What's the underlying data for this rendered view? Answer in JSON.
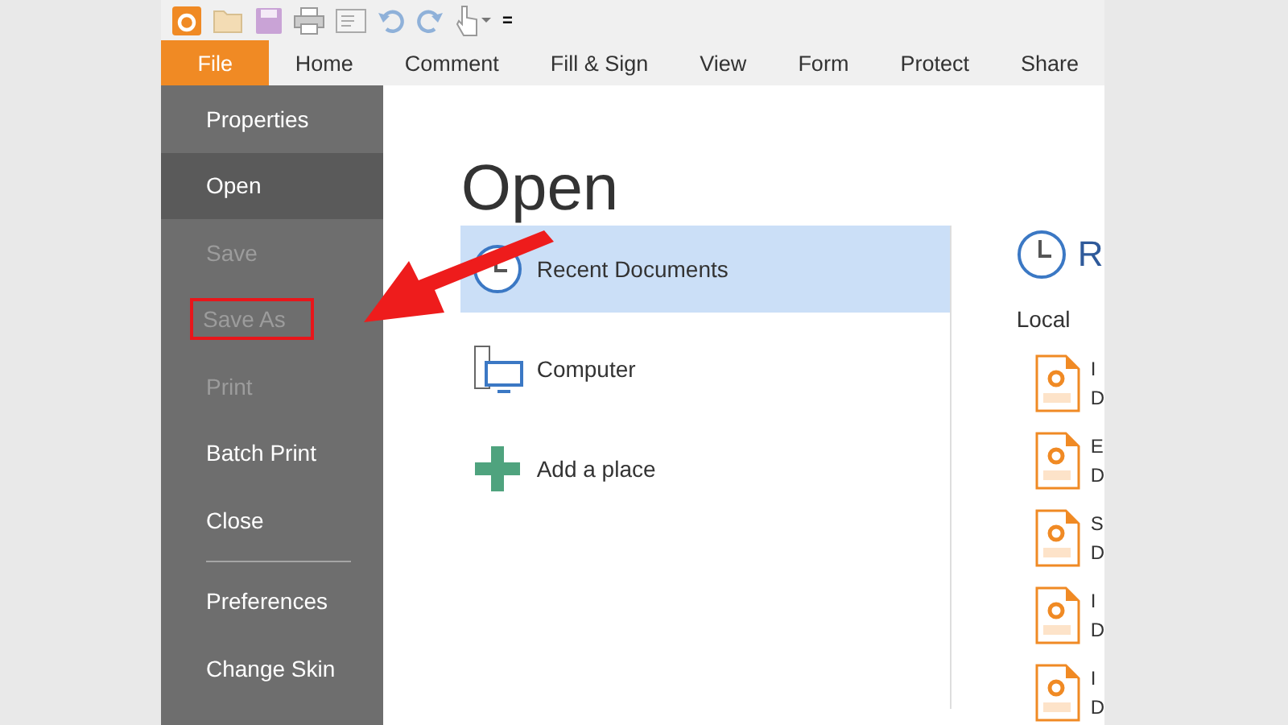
{
  "quick_toolbar": {
    "overflow": "="
  },
  "tabs": [
    {
      "label": "File",
      "selected": true
    },
    {
      "label": "Home",
      "selected": false
    },
    {
      "label": "Comment",
      "selected": false
    },
    {
      "label": "Fill & Sign",
      "selected": false
    },
    {
      "label": "View",
      "selected": false
    },
    {
      "label": "Form",
      "selected": false
    },
    {
      "label": "Protect",
      "selected": false
    },
    {
      "label": "Share",
      "selected": false
    }
  ],
  "sidebar": {
    "items": [
      {
        "kind": "item",
        "label": "Properties",
        "selected": false,
        "disabled": false,
        "highlighted": false
      },
      {
        "kind": "item",
        "label": "Open",
        "selected": true,
        "disabled": false,
        "highlighted": false
      },
      {
        "kind": "item",
        "label": "Save",
        "selected": false,
        "disabled": true,
        "highlighted": false
      },
      {
        "kind": "item",
        "label": "Save As",
        "selected": false,
        "disabled": true,
        "highlighted": true
      },
      {
        "kind": "item",
        "label": "Print",
        "selected": false,
        "disabled": true,
        "highlighted": false
      },
      {
        "kind": "item",
        "label": "Batch Print",
        "selected": false,
        "disabled": false,
        "highlighted": false
      },
      {
        "kind": "item",
        "label": "Close",
        "selected": false,
        "disabled": false,
        "highlighted": false
      },
      {
        "kind": "separator"
      },
      {
        "kind": "item",
        "label": "Preferences",
        "selected": false,
        "disabled": false,
        "highlighted": false
      },
      {
        "kind": "item",
        "label": "Change Skin",
        "selected": false,
        "disabled": false,
        "highlighted": false
      }
    ]
  },
  "page_title": "Open",
  "places": [
    {
      "kind": "clock",
      "label": "Recent Documents",
      "selected": true
    },
    {
      "kind": "computer",
      "label": "Computer",
      "selected": false
    },
    {
      "kind": "plus",
      "label": "Add a place",
      "selected": false
    }
  ],
  "recent": {
    "title": "R",
    "section": "Local",
    "files": [
      {
        "name": "I",
        "detail": "D"
      },
      {
        "name": "E",
        "detail": "D"
      },
      {
        "name": "S",
        "detail": "D"
      },
      {
        "name": "I",
        "detail": "D"
      },
      {
        "name": "I",
        "detail": "D"
      }
    ]
  }
}
